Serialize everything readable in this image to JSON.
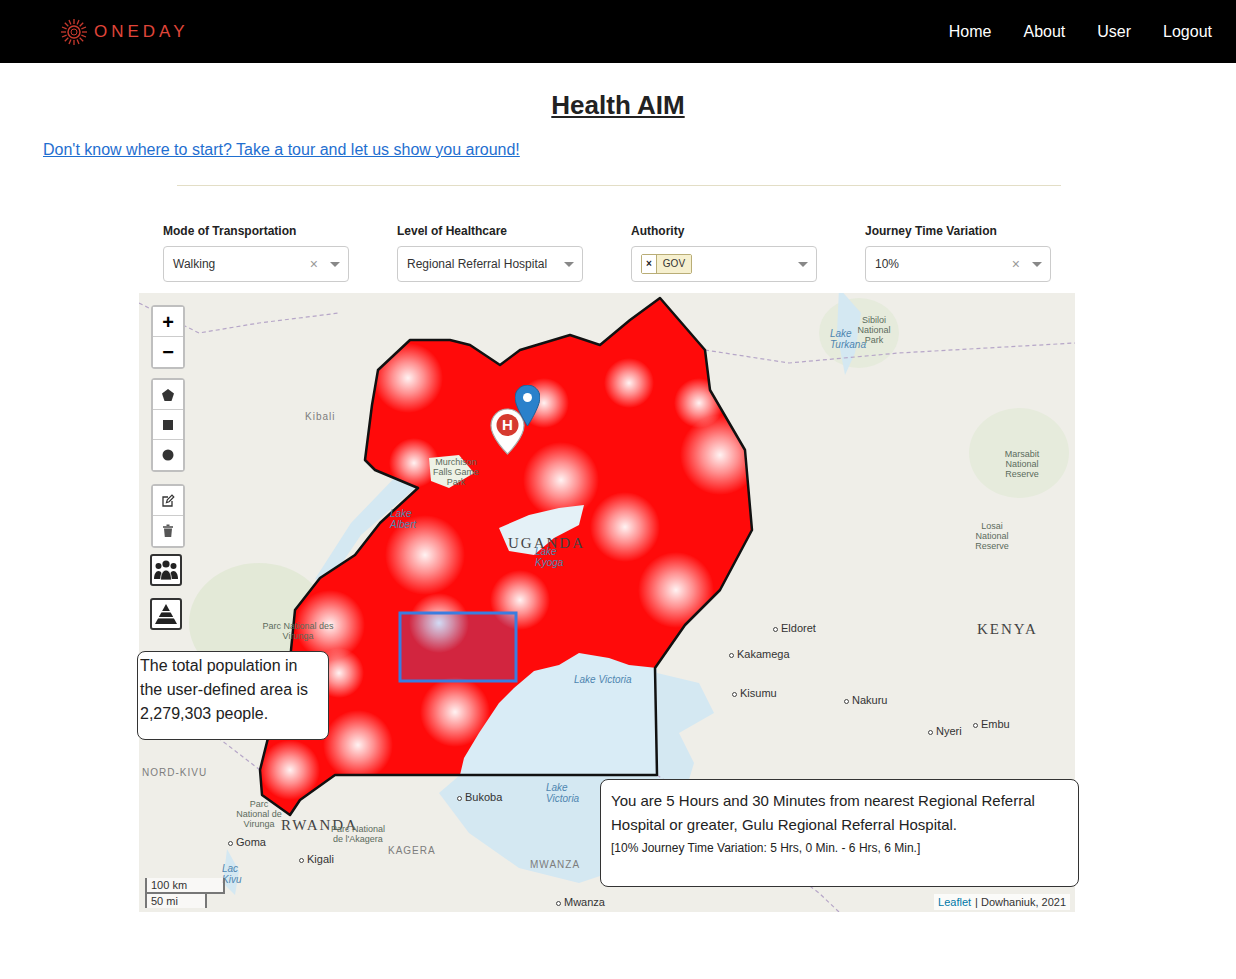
{
  "brand": {
    "name": "ONEDAY"
  },
  "nav": [
    {
      "label": "Home"
    },
    {
      "label": "About"
    },
    {
      "label": "User"
    },
    {
      "label": "Logout"
    }
  ],
  "page": {
    "title": "Health AIM",
    "tour_link": "Don't know where to start? Take a tour and let us show you around!"
  },
  "filters": [
    {
      "kind": "select",
      "label": "Mode of Transportation",
      "value": "Walking",
      "clear": "×"
    },
    {
      "kind": "select",
      "label": "Level of Healthcare",
      "value": "Regional Referral Hospital"
    },
    {
      "kind": "tags",
      "label": "Authority",
      "tags": [
        {
          "remove": "×",
          "label": "GOV"
        }
      ]
    },
    {
      "kind": "select",
      "label": "Journey Time Variation",
      "value": "10%",
      "clear": "×"
    }
  ],
  "map": {
    "zoom": [
      "+",
      "−"
    ],
    "labels": [
      {
        "text": "Lake Turkana",
        "kind": "water"
      },
      {
        "text": "Sibiloi National Park",
        "kind": "park"
      },
      {
        "text": "Kibali",
        "kind": "region"
      },
      {
        "text": "Murchison Falls Game Park",
        "kind": "park"
      },
      {
        "text": "Lake Albert",
        "kind": "water"
      },
      {
        "text": "UGANDA",
        "kind": "country"
      },
      {
        "text": "Lake Kyoga",
        "kind": "water"
      },
      {
        "text": "Marsabit National Reserve",
        "kind": "park"
      },
      {
        "text": "Losai National Reserve",
        "kind": "park"
      },
      {
        "text": "KENYA",
        "kind": "country"
      },
      {
        "text": "Eldoret",
        "kind": "city"
      },
      {
        "text": "Kakamega",
        "kind": "city"
      },
      {
        "text": "Kisumu",
        "kind": "city"
      },
      {
        "text": "Nakuru",
        "kind": "city"
      },
      {
        "text": "Nyeri",
        "kind": "city"
      },
      {
        "text": "Embu",
        "kind": "city"
      },
      {
        "text": "Lake Victoria",
        "kind": "water"
      },
      {
        "text": "Lake Victoria",
        "kind": "water"
      },
      {
        "text": "Bukoba",
        "kind": "city"
      },
      {
        "text": "KAGERA",
        "kind": "region"
      },
      {
        "text": "MWANZA",
        "kind": "region"
      },
      {
        "text": "Mwanza",
        "kind": "city"
      },
      {
        "text": "RWANDA",
        "kind": "country"
      },
      {
        "text": "Kigali",
        "kind": "city"
      },
      {
        "text": "Goma",
        "kind": "city"
      },
      {
        "text": "Parc National des Virunga",
        "kind": "park"
      },
      {
        "text": "Parc National de Virunga",
        "kind": "park"
      },
      {
        "text": "Parc National de l'Akagera",
        "kind": "park"
      },
      {
        "text": "NORD-KIVU",
        "kind": "region"
      },
      {
        "text": "Lac Kivu",
        "kind": "water"
      }
    ],
    "hospital_marker": {
      "letter": "H"
    },
    "population_popup": "The total population in the user-defined area is 2,279,303 people.",
    "route_popup": {
      "text": "You are 5 Hours and 30 Minutes from nearest Regional Referral Hospital or greater, Gulu Regional Referral Hospital.",
      "variation": "[10% Journey Time Variation: 5 Hrs, 0 Min. - 6 Hrs, 6 Min.]"
    },
    "scale": {
      "metric": "100 km",
      "imperial": "50 mi"
    },
    "attribution": {
      "link": "Leaflet",
      "text": "| Dowhaniuk, 2021"
    }
  }
}
